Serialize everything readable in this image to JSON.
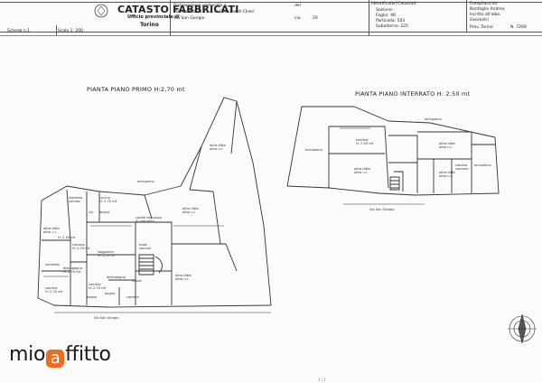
{
  "header": {
    "scheda_label": "Scheda n.1",
    "scala_label": "Scala 1: 200",
    "catasto_title": "CATASTO FABBRICATI",
    "ufficio": "Ufficio provinciale di",
    "city": "Torino",
    "dichiarazione_label": "Dichiarazione protocollo n.",
    "del_label": "del",
    "planimetria_label": "Planimetria di u.i.u. in Comune di Chieri",
    "via": "Via San Giorgio",
    "civ_label": "civ.",
    "civ_value": "20",
    "ident_title": "Identificativi Catastali:",
    "sezione": "Sezione:",
    "foglio": "Foglio: 96",
    "particella": "Particella: 503",
    "subalterno": "Subalterno: 225",
    "compilata_title": "Compilata da:",
    "compilata_name": "Bonfaglio Andrea",
    "iscritto": "Iscritto all'albo:",
    "geometri": "Geometri",
    "prov": "Prov. Torino",
    "numero": "N. 7269"
  },
  "plans": {
    "left_title": "PIANTA PIANO PRIMO H:2,70 mt",
    "right_title": "PIANTA PIANO INTERRATO H: 2,50 mt",
    "left_street": "Via San Giorgio",
    "right_street": "Via San Giorgio"
  },
  "rooms_left": [
    {
      "id": "ingresso",
      "text": "ingresso\ncorrido"
    },
    {
      "id": "cucina",
      "text": "cucina\nH: 2,70 mt"
    },
    {
      "id": "bagno1",
      "text": "bagno"
    },
    {
      "id": "rip",
      "text": "rip."
    },
    {
      "id": "altra_ditta_left",
      "text": "altra ditta\naltro u.i."
    },
    {
      "id": "h_left",
      "text": "H: 2,40 mt"
    },
    {
      "id": "soggiorno",
      "text": "soggiorno\nH: 2,70 mt"
    },
    {
      "id": "camera1",
      "text": "camera\nH: 2,70 mt"
    },
    {
      "id": "corridoio",
      "text": "corridoio"
    },
    {
      "id": "disimpegno",
      "text": "disimpegno\nH: 2,70 mt"
    },
    {
      "id": "camera2",
      "text": "camera\nH: 2,70 mt"
    },
    {
      "id": "camera3",
      "text": "camera\nH: 2,70 mt"
    },
    {
      "id": "bagno2",
      "text": "bagno"
    },
    {
      "id": "ripost",
      "text": "ripost."
    },
    {
      "id": "scale",
      "text": "scale\ncomuni"
    },
    {
      "id": "cortile",
      "text": "cortile esclusivo\ndi proprietà"
    },
    {
      "id": "altra_ditta_mid",
      "text": "altra ditta\naltro u.i."
    },
    {
      "id": "altra_ditta_top",
      "text": "altra ditta\naltro u.i."
    },
    {
      "id": "altra_ditta_bottom",
      "text": "altra ditta\naltro u.i."
    },
    {
      "id": "terrapieno_left",
      "text": "terrapieno"
    },
    {
      "id": "disimp2",
      "text": "disimpegno"
    },
    {
      "id": "camera4",
      "text": "camera"
    },
    {
      "id": "bagno3",
      "text": "bagno"
    }
  ],
  "rooms_right": [
    {
      "id": "terrapieno_r1",
      "text": "terrapieno"
    },
    {
      "id": "terrapieno_r2",
      "text": "terrapieno"
    },
    {
      "id": "terrapieno_r3",
      "text": "terrapieno"
    },
    {
      "id": "cantina",
      "text": "cantina\nH: 2,50 mt"
    },
    {
      "id": "altra_ditta_r1",
      "text": "altra ditta\naltro u.i."
    },
    {
      "id": "altra_ditta_r2",
      "text": "altra ditta\naltro u.i."
    },
    {
      "id": "altra_ditta_r3",
      "text": "altra ditta\naltro u.i."
    },
    {
      "id": "cantina_comune",
      "text": "cantina\ncomune"
    }
  ],
  "brand": {
    "prefix": "mio",
    "mark": "a",
    "suffix": "ffitto",
    "mark_color": "#ee6a1f"
  },
  "footer": {
    "page_mark": "1 / 1"
  }
}
